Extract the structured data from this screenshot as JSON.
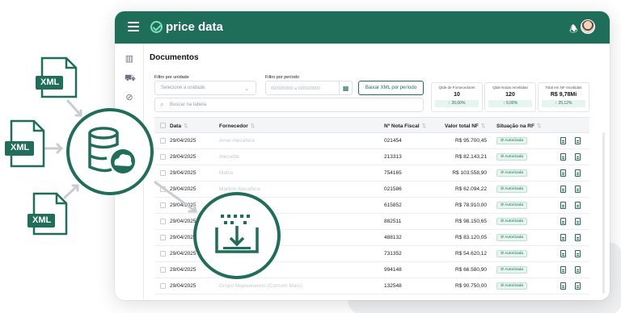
{
  "app": {
    "brand": "price data"
  },
  "page": {
    "title": "Documentos"
  },
  "filters": {
    "unit_label": "Filtro por unidade",
    "unit_placeholder": "Selecione a unidade",
    "period_label": "Filtro por período",
    "period_placeholder": "00/00/0000 a 00/00/0000",
    "download_button": "Baixar XML por período",
    "search_placeholder": "Buscar na tabela"
  },
  "stats": [
    {
      "title": "Qtde de Fornecedores",
      "value": "10",
      "change": "20,00%"
    },
    {
      "title": "Qtde Notas recebidas",
      "value": "120",
      "change": "9,00%"
    },
    {
      "title": "Total em NF recebidas",
      "value": "R$ 9,78Mi",
      "change": "25,12%"
    }
  ],
  "table": {
    "headers": {
      "date": "Data",
      "supplier": "Fornecedor",
      "nf_number": "Nº Nota Fiscal",
      "nf_value": "Valor total NF",
      "rf_status": "Situação na RF"
    },
    "rows": [
      {
        "date": "29/04/2025",
        "supplier": "Amei Alecafera",
        "nf": "021454",
        "value": "R$ 95.700,45",
        "status": "Autorizada"
      },
      {
        "date": "29/04/2025",
        "supplier": "Alecafde",
        "nf": "213313",
        "value": "R$ 82.143,21",
        "status": "Autorizada"
      },
      {
        "date": "29/04/2025",
        "supplier": "Malco",
        "nf": "754165",
        "value": "R$ 103.558,90",
        "status": "Autorizada"
      },
      {
        "date": "29/04/2025",
        "supplier": "Martins Alecafera",
        "nf": "021586",
        "value": "R$ 62.094,22",
        "status": "Autorizada"
      },
      {
        "date": "29/04/2025",
        "supplier": "",
        "nf": "615852",
        "value": "R$ 78.910,00",
        "status": "Autorizada"
      },
      {
        "date": "29/04/2025",
        "supplier": "",
        "nf": "882511",
        "value": "R$ 98.150,65",
        "status": "Autorizada"
      },
      {
        "date": "29/04/2025",
        "supplier": "",
        "nf": "488132",
        "value": "R$ 83.120,05",
        "status": "Autorizada"
      },
      {
        "date": "29/04/2025",
        "supplier": "",
        "nf": "731352",
        "value": "R$ 54.620,12",
        "status": "Autorizada"
      },
      {
        "date": "29/04/2025",
        "supplier": "",
        "nf": "994148",
        "value": "R$ 66.580,90",
        "status": "Autorizada"
      },
      {
        "date": "29/04/2025",
        "supplier": "Grupo Mapeamento (Comum Mais)",
        "nf": "132548",
        "value": "R$ 90.750,00",
        "status": "Autorizada"
      }
    ]
  },
  "illustration": {
    "file_label": "XML",
    "accent": "#1f6e59"
  },
  "colors": {
    "brand": "#1f6e59",
    "badge_bg": "#e6f5ee"
  }
}
